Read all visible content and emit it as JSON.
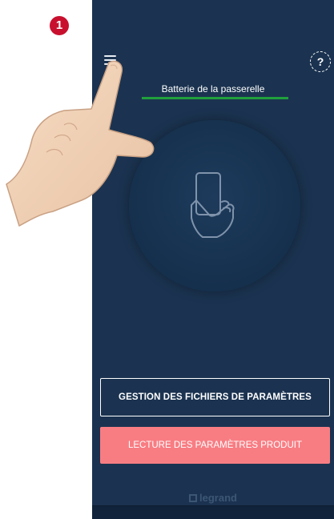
{
  "instruction": {
    "step": "1"
  },
  "header": {
    "menu_icon": "hamburger-menu-icon",
    "help_icon": "help-icon",
    "help_glyph": "?"
  },
  "battery": {
    "label": "Batterie de la passerelle",
    "level_fraction": 1.0,
    "color": "#20a03c"
  },
  "main": {
    "illustration_icon": "hand-holding-phone-icon"
  },
  "buttons": {
    "settings_files": "GESTION DES FICHIERS DE PARAMÈTRES",
    "read_parameters": "LECTURE DES PARAMÈTRES PRODUIT"
  },
  "footer": {
    "brand": "legrand"
  },
  "colors": {
    "background": "#1b3350",
    "accent_button": "#f87d83",
    "step_badge": "#c8102e"
  }
}
